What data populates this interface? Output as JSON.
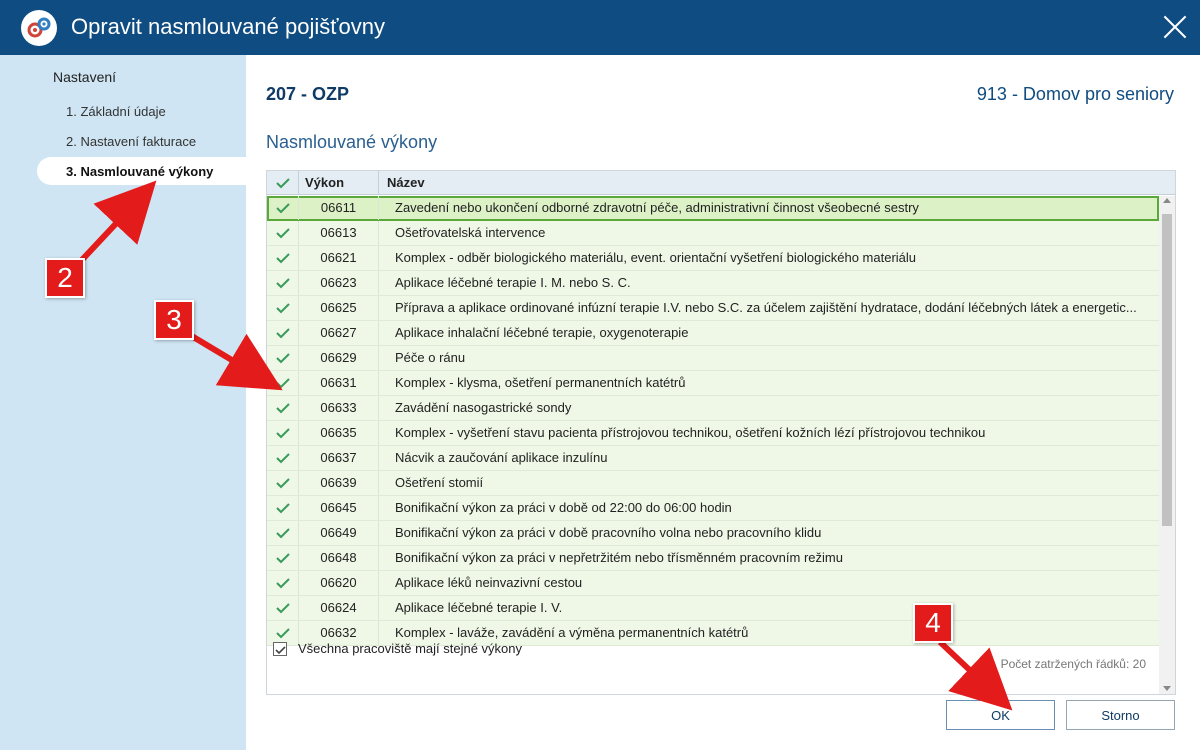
{
  "window": {
    "title": "Opravit nasmlouvané pojišťovny"
  },
  "sidebar": {
    "header": "Nastavení",
    "items": [
      {
        "label": "1. Základní údaje"
      },
      {
        "label": "2. Nastavení fakturace"
      },
      {
        "label": "3. Nasmlouvané výkony",
        "active": true
      }
    ]
  },
  "header": {
    "insurance_code": "207 - OZP",
    "facility": "913 - Domov pro seniory"
  },
  "section_title": "Nasmlouvané výkony",
  "table": {
    "columns": [
      "Výkon",
      "Název"
    ],
    "rows": [
      {
        "code": "06611",
        "name": "Zavedení nebo ukončení odborné zdravotní péče, administrativní činnost všeobecné sestry",
        "selected": true
      },
      {
        "code": "06613",
        "name": "Ošetřovatelská intervence"
      },
      {
        "code": "06621",
        "name": "Komplex - odběr biologického materiálu, event. orientační vyšetření biologického materiálu"
      },
      {
        "code": "06623",
        "name": "Aplikace léčebné terapie I. M. nebo S. C."
      },
      {
        "code": "06625",
        "name": "Příprava a aplikace ordinované infúzní terapie I.V. nebo S.C. za účelem zajištění hydratace, dodání léčebných látek a energetic..."
      },
      {
        "code": "06627",
        "name": "Aplikace inhalační léčebné terapie, oxygenoterapie"
      },
      {
        "code": "06629",
        "name": "Péče o ránu"
      },
      {
        "code": "06631",
        "name": "Komplex - klysma, ošetření permanentních katétrů"
      },
      {
        "code": "06633",
        "name": "Zavádění nasogastrické sondy"
      },
      {
        "code": "06635",
        "name": "Komplex - vyšetření stavu pacienta přístrojovou technikou, ošetření kožních lézí přístrojovou technikou"
      },
      {
        "code": "06637",
        "name": "Nácvik a zaučování aplikace inzulínu"
      },
      {
        "code": "06639",
        "name": "Ošetření stomií"
      },
      {
        "code": "06645",
        "name": "Bonifikační výkon za práci v době od 22:00 do 06:00 hodin"
      },
      {
        "code": "06649",
        "name": "Bonifikační výkon za práci v době pracovního volna nebo pracovního klidu"
      },
      {
        "code": "06648",
        "name": "Bonifikační výkon za práci v nepřetržitém nebo třísměnném pracovním režimu"
      },
      {
        "code": "06620",
        "name": "Aplikace léků neinvazivní cestou"
      },
      {
        "code": "06624",
        "name": "Aplikace léčebné terapie I. V."
      },
      {
        "code": "06632",
        "name": "Komplex - laváže, zavádění a výměna permanentních katétrů"
      }
    ]
  },
  "checkbox": {
    "label": "Všechna pracoviště mají stejné výkony",
    "checked": true
  },
  "row_count_text": "Počet zatržených řádků: 20",
  "buttons": {
    "ok": "OK",
    "cancel": "Storno"
  },
  "annotations": {
    "badge_2": "2",
    "badge_3": "3",
    "badge_4": "4"
  },
  "colors": {
    "titlebar": "#0f4c81",
    "sidebar": "#cfe5f3",
    "row_bg": "#eff8e7",
    "selected_row": "#ddf1c7",
    "check": "#3a9a5a",
    "badge": "#e31b1b"
  }
}
